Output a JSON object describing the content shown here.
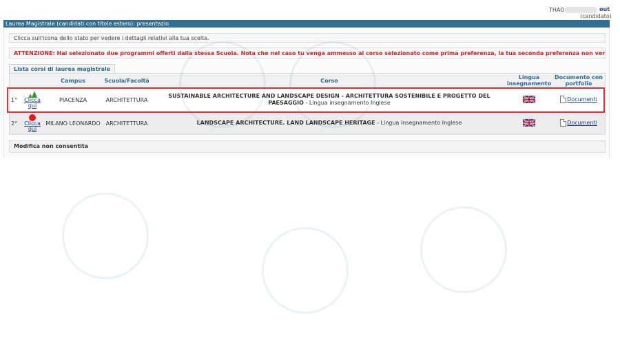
{
  "header": {
    "user_name": "THAO",
    "logout": "out",
    "role": "(candidato)"
  },
  "section_title": "Laurea Magistrale (candidati con titolo estero): presentazio",
  "info_text": "Clicca sull'icona dello stato per vedere i dettagli relativi alla tua scelta.",
  "warning_text": "ATTENZIONE: Hai selezionato due programmi offerti dalla stessa Scuola. Nota che nel caso tu venga ammesso al corso selezionato come prima preferenza, la tua seconda preferenza non verrà valutata.",
  "list_title": "Lista corsi di laurea magistrale",
  "table": {
    "headers": {
      "campus": "Campus",
      "school": "Scuola/Facoltà",
      "course": "Corso",
      "language": "Lingua insegnamento",
      "portfolio": "Documento con portfolio"
    },
    "rows": [
      {
        "priority": "1°",
        "status_link": "Clicca qui",
        "status_icon": "green-triangle-icon",
        "campus": "PIACENZA",
        "school": "ARCHITETTURA",
        "course_name": "SUSTAINABLE ARCHITECTURE AND LANDSCAPE DESIGN - ARCHITETTURA SOSTENIBILE E PROGETTO DEL PAESAGGIO",
        "course_lang": "Lingua insegnamento Inglese",
        "flag_icon": "uk-flag-icon",
        "document_link": "Documenti"
      },
      {
        "priority": "2°",
        "status_link": "Clicca qui",
        "status_icon": "red-circle-icon",
        "campus": "MILANO LEONARDO",
        "school": "ARCHITETTURA",
        "course_name": "LANDSCAPE ARCHITECTURE. LAND LANDSCAPE HERITAGE",
        "course_lang": "Lingua insegnamento Inglese",
        "flag_icon": "uk-flag-icon",
        "document_link": "Documenti"
      }
    ]
  },
  "footer_note": "Modifica non consentita",
  "colors": {
    "title_bar": "#2f6f95",
    "warning": "#d42323",
    "highlight": "#e03030",
    "link": "#1a3f8f"
  }
}
